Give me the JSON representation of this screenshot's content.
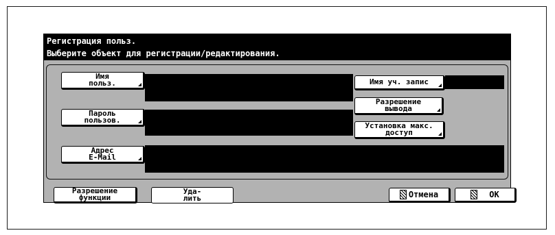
{
  "title": {
    "line1": "Регистрация польз.",
    "line2": "Выберите объект для регистрации/редактирования."
  },
  "fields": {
    "user_name": {
      "label": "Имя польз.",
      "value": ""
    },
    "password": {
      "label": "Пароль пользов.",
      "value": ""
    },
    "email": {
      "label": "Адрес E-Mail",
      "value": ""
    },
    "account_name": {
      "label": "Имя уч. запис",
      "value": ""
    }
  },
  "buttons": {
    "output_permission": "Разрешение вывода",
    "max_access": "Установка макс. доступ",
    "function_permission": "Разрешение функции",
    "delete": "Уда- лить",
    "cancel": "Отмена",
    "ok": "OK"
  },
  "icons": {
    "cancel": "cancel-icon",
    "ok": "ok-icon"
  }
}
